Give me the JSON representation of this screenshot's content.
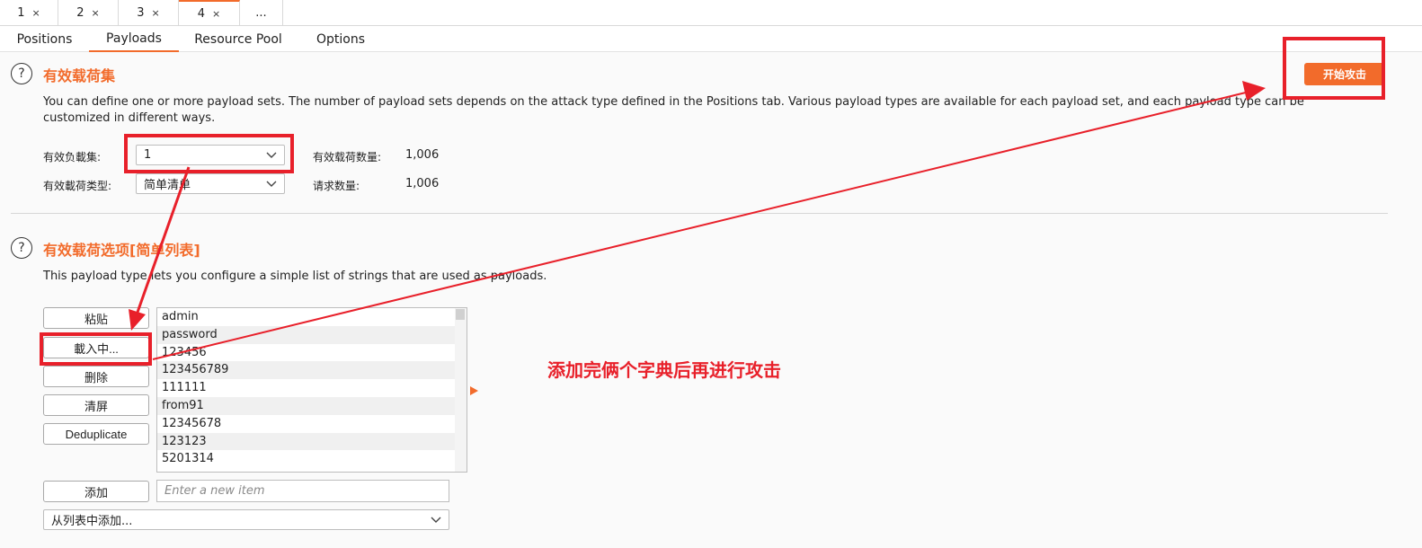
{
  "attack_tabs": [
    {
      "label": "1",
      "close": "×"
    },
    {
      "label": "2",
      "close": "×"
    },
    {
      "label": "3",
      "close": "×"
    },
    {
      "label": "4",
      "close": "×"
    },
    {
      "label": "..."
    }
  ],
  "sub_tabs": [
    {
      "label": "Positions"
    },
    {
      "label": "Payloads"
    },
    {
      "label": "Resource Pool"
    },
    {
      "label": "Options"
    }
  ],
  "active_sub_tab": "Payloads",
  "payload_sets": {
    "help": "?",
    "title": "有效载荷集",
    "description": "You can define one or more payload sets. The number of payload sets depends on the attack type defined in the Positions tab. Various payload types are available for each payload set, and each payload type can be customized in different ways.",
    "start_attack_label": "开始攻击",
    "set_label": "有效负載集:",
    "set_value": "1",
    "type_label": "有效載荷类型:",
    "type_value": "简单清单",
    "count_label": "有效载荷数量:",
    "count_value": "1,006",
    "request_label": "请求数量:",
    "request_value": "1,006"
  },
  "payload_options": {
    "help": "?",
    "title": "有效载荷选项[简单列表]",
    "description": "This payload type lets you configure a simple list of strings that are used as payloads.",
    "buttons": {
      "paste": "粘贴",
      "load": "載入中...",
      "remove": "删除",
      "clear": "清屏",
      "deduplicate": "Deduplicate",
      "add": "添加"
    },
    "items": [
      "admin",
      "password",
      "123456",
      "123456789",
      "111111",
      "from91",
      "12345678",
      "123123",
      "5201314"
    ],
    "add_placeholder": "Enter a new item",
    "add_from_list": "从列表中添加..."
  },
  "annotation_text": "添加完俩个字典后再进行攻击",
  "colors": {
    "accent": "#f26b2b",
    "annotation_red": "#e8202a"
  },
  "icons": [
    "help-circle-icon",
    "chevron-down-icon",
    "expand-arrow-icon",
    "close-icon"
  ]
}
